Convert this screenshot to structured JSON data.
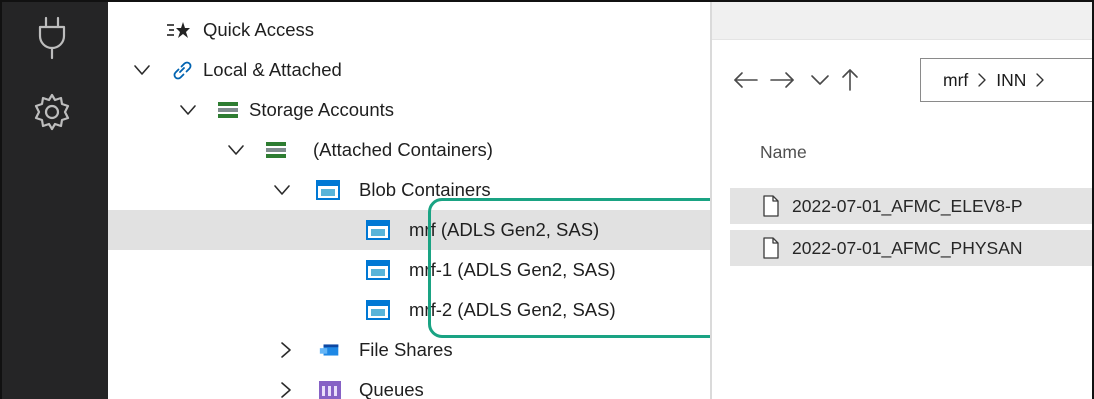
{
  "tree": {
    "items": [
      {
        "label": "Quick Access",
        "icon": "quick-access-icon"
      },
      {
        "label": "Local & Attached",
        "icon": "link-icon",
        "expanded": true
      },
      {
        "label": "Storage Accounts",
        "icon": "storage-accounts-icon",
        "expanded": true
      },
      {
        "label": "(Attached Containers)",
        "icon": "storage-accounts-icon",
        "expanded": true
      },
      {
        "label": "Blob Containers",
        "icon": "blob-containers-icon",
        "expanded": true
      },
      {
        "label": "mrf (ADLS Gen2, SAS)",
        "icon": "blob-container-icon",
        "selected": true
      },
      {
        "label": "mrf-1 (ADLS Gen2, SAS)",
        "icon": "blob-container-icon"
      },
      {
        "label": "mrf-2 (ADLS Gen2, SAS)",
        "icon": "blob-container-icon"
      },
      {
        "label": "File Shares",
        "icon": "file-shares-icon",
        "expanded": false
      },
      {
        "label": "Queues",
        "icon": "queues-icon",
        "expanded": false
      }
    ]
  },
  "activity_bar": {
    "items": [
      {
        "icon": "plug-icon"
      },
      {
        "icon": "gear-icon"
      }
    ]
  },
  "explorer": {
    "nav": {
      "back_icon": "arrow-left-icon",
      "forward_icon": "arrow-right-icon",
      "recent_icon": "chevron-down-icon",
      "up_icon": "arrow-up-icon"
    },
    "breadcrumb": [
      "mrf",
      "INN"
    ],
    "columns": {
      "name": "Name"
    },
    "files": [
      {
        "name": "2022-07-01_AFMC_ELEV8-P",
        "icon": "file-icon"
      },
      {
        "name": "2022-07-01_AFMC_PHYSAN",
        "icon": "file-icon"
      }
    ]
  },
  "colors": {
    "activity_bar_bg": "#252526",
    "selection_bg": "#e1e1e1",
    "callout_border": "#1aa383",
    "storage_icon": "#2e7d32",
    "blob_icon": "#0078d4",
    "queue_icon": "#8661c5"
  }
}
